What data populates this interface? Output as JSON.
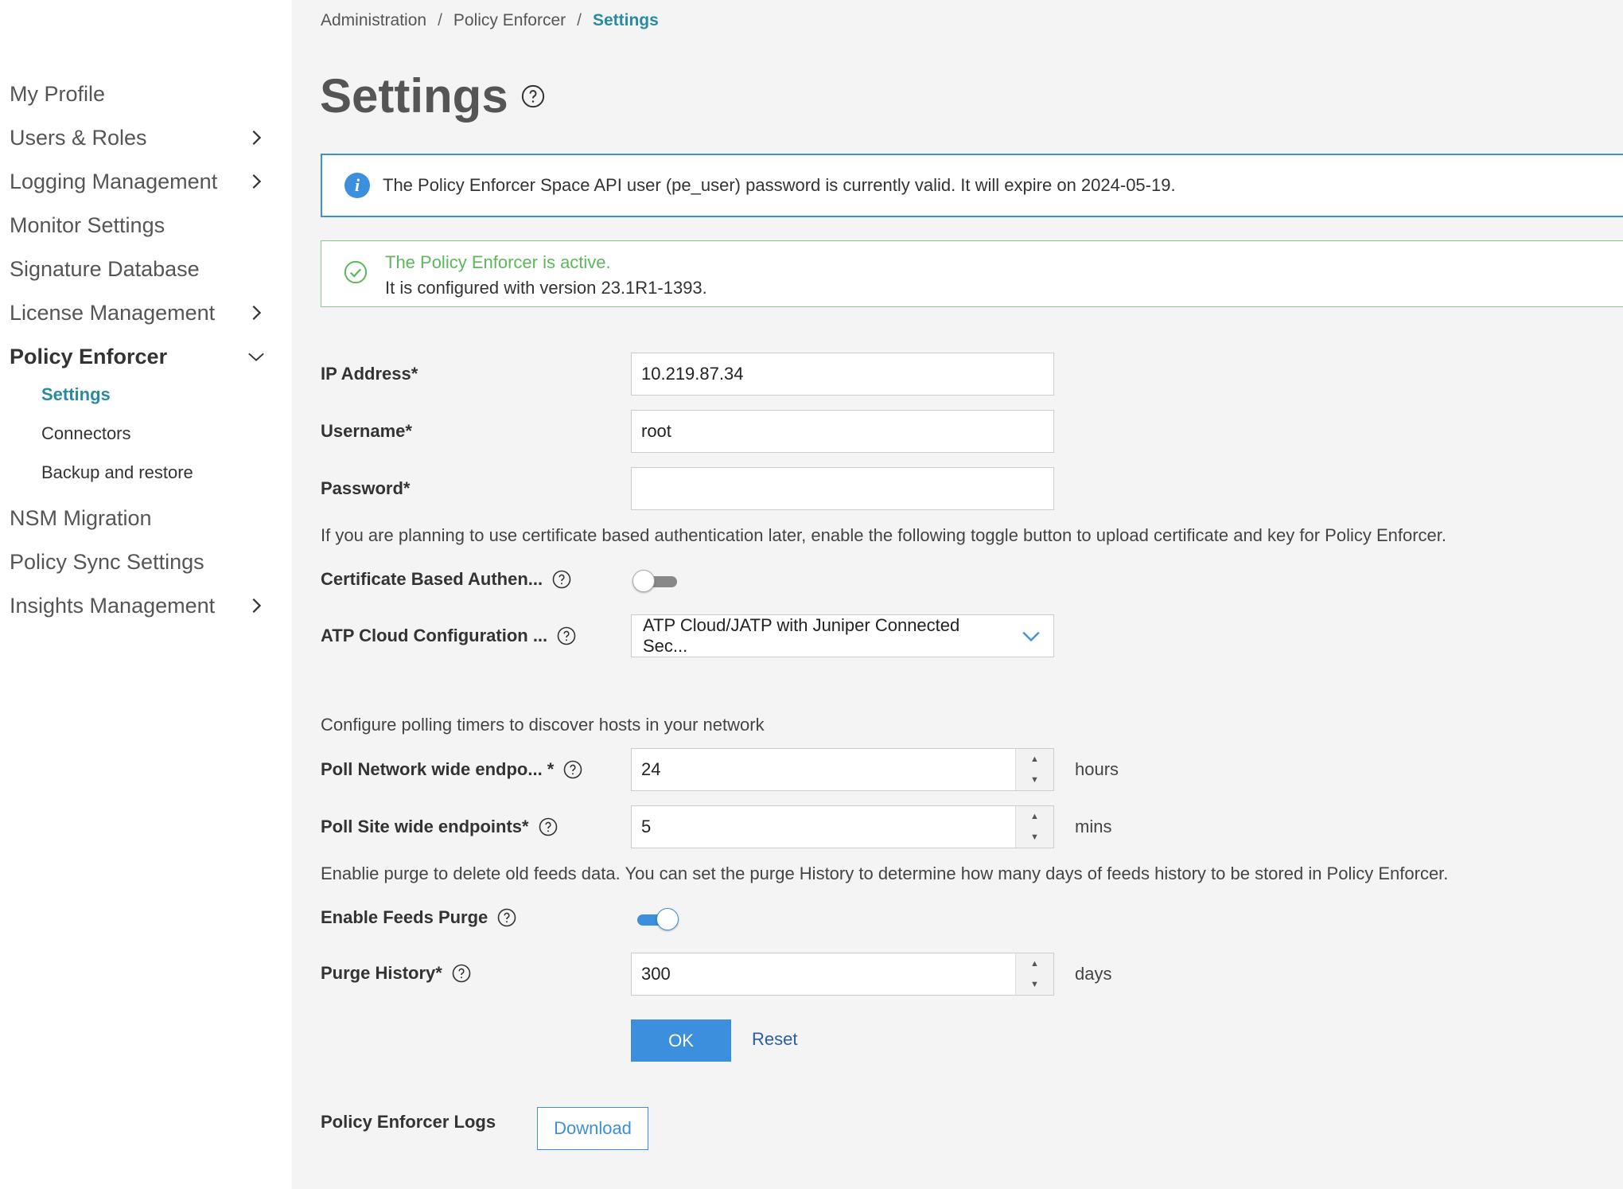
{
  "sidebar": {
    "items": [
      {
        "label": "My Profile"
      },
      {
        "label": "Users & Roles"
      },
      {
        "label": "Logging Management"
      },
      {
        "label": "Monitor Settings"
      },
      {
        "label": "Signature Database"
      },
      {
        "label": "License Management"
      },
      {
        "label": "Policy Enforcer"
      },
      {
        "label": "NSM Migration"
      },
      {
        "label": "Policy Sync Settings"
      },
      {
        "label": "Insights Management"
      }
    ],
    "sub_items": [
      {
        "label": "Settings"
      },
      {
        "label": "Connectors"
      },
      {
        "label": "Backup and restore"
      }
    ]
  },
  "breadcrumb": {
    "items": [
      "Administration",
      "Policy Enforcer",
      "Settings"
    ],
    "separator": "/"
  },
  "page": {
    "title": "Settings"
  },
  "info_banner": {
    "icon": "info-icon",
    "text": "The Policy Enforcer Space API user (pe_user) password is currently valid. It will expire on 2024-05-19."
  },
  "success_banner": {
    "title": "The Policy Enforcer is active.",
    "text": "It is configured with version 23.1R1-1393."
  },
  "form": {
    "ip_label": "IP Address*",
    "ip_value": "10.219.87.34",
    "username_label": "Username*",
    "username_value": "root",
    "password_label": "Password*",
    "password_value": "",
    "cert_desc": "If you are planning to use certificate based authentication later, enable the following toggle button to upload certificate and key for Policy Enforcer.",
    "cert_label": "Certificate Based Authen...",
    "cert_enabled": false,
    "atp_label": "ATP Cloud Configuration ...",
    "atp_value": "ATP Cloud/JATP with Juniper Connected Sec...",
    "polling_desc": "Configure polling timers to discover hosts in your network",
    "poll_network_label": "Poll Network wide endpo... *",
    "poll_network_value": "24",
    "poll_network_unit": "hours",
    "poll_site_label": "Poll Site wide endpoints*",
    "poll_site_value": "5",
    "poll_site_unit": "mins",
    "purge_desc": "Enablie purge to delete old feeds data. You can set the purge History to determine how many days of feeds history to be stored in Policy Enforcer.",
    "feeds_purge_label": "Enable Feeds Purge",
    "feeds_purge_enabled": true,
    "purge_history_label": "Purge History*",
    "purge_history_value": "300",
    "purge_history_unit": "days",
    "ok_label": "OK",
    "reset_label": "Reset",
    "logs_label": "Policy Enforcer Logs",
    "download_label": "Download"
  },
  "colors": {
    "accent": "#3b8fdc",
    "active_nav": "#2a8aa0",
    "success": "#5cb85c"
  }
}
